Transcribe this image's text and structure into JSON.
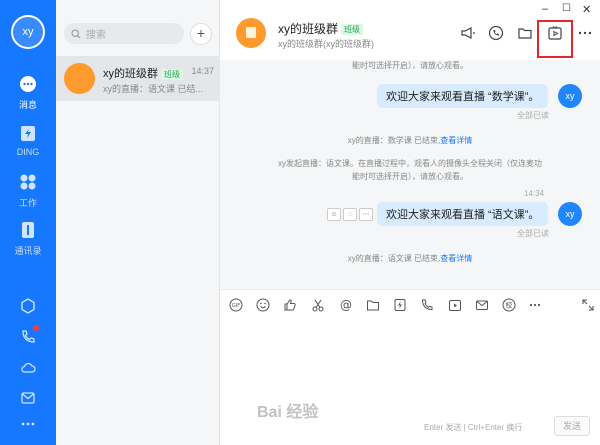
{
  "nav": {
    "avatar": "xy",
    "items": [
      {
        "label": "消息",
        "icon": "chat-bubble-icon"
      },
      {
        "label": "DING",
        "icon": "ding-icon"
      },
      {
        "label": "工作",
        "icon": "apps-grid-icon"
      },
      {
        "label": "通讯录",
        "icon": "contacts-icon"
      }
    ],
    "bottom_icons": [
      "hexagon-icon",
      "phone-icon",
      "cloud-icon",
      "mail-icon",
      "more-icon"
    ],
    "accent": "#1677ff"
  },
  "search": {
    "placeholder": "搜索"
  },
  "conversation": {
    "name": "xy的班级群",
    "badge": "班级",
    "time": "14:37",
    "preview": "xy的直播：语文课 已结..."
  },
  "header": {
    "title": "xy的班级群",
    "badge": "班级",
    "subtitle": "xy的班级群(xy的班级群)",
    "controls": [
      "–",
      "☐",
      "✕"
    ]
  },
  "messages": {
    "sys_top": "能时可选择开启），请放心观看。",
    "bubble1": "欢迎大家来观看直播 “数学课”。",
    "read1": "全部已读",
    "sys_end1_text": "xy的直播：数学课 已结束,",
    "sys_end1_link": "查看详情",
    "sys_start2_line1": "xy发起直播：语文课。在直播过程中，观看人的摄像头全程关闭（仅连麦功",
    "sys_start2_line2": "能时可选择开启），请放心观看。",
    "time2": "14:34",
    "bubble2": "欢迎大家来观看直播 “语文课”。",
    "read2": "全部已读",
    "sys_end2_text": "xy的直播：语文课 已结束,",
    "sys_end2_link": "查看详情",
    "avatar": "xy"
  },
  "composer": {
    "hint": "Enter 发送 | Ctrl+Enter 换行",
    "send": "发送"
  },
  "watermark": "Bai 经验"
}
